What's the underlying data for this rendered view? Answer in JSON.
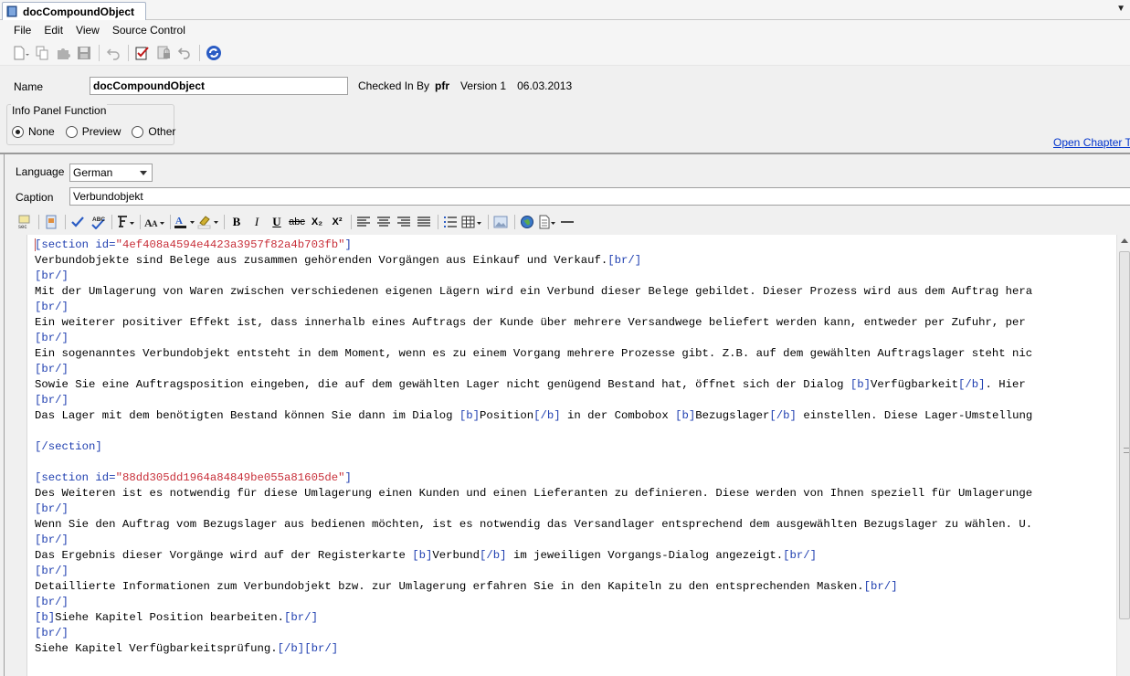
{
  "tab": {
    "title": "docCompoundObject"
  },
  "menu": {
    "items": [
      "File",
      "Edit",
      "View",
      "Source Control"
    ]
  },
  "header": {
    "name_label": "Name",
    "name_value": "docCompoundObject",
    "checked_in_label": "Checked In By",
    "checked_in_user": "pfr",
    "version": "Version 1",
    "date": "06.03.2013",
    "info_panel_label": "Info Panel Function",
    "radio_none": "None",
    "radio_preview": "Preview",
    "radio_other": "Other",
    "chapter_link": "Open Chapter Tre"
  },
  "form": {
    "language_label": "Language",
    "language_value": "German",
    "caption_label": "Caption",
    "caption_value": "Verbundobjekt"
  },
  "editor_toolbar": {
    "spell": "ABC",
    "bold": "B",
    "italic": "I",
    "underline": "U",
    "strike": "abc",
    "subscript": "X₂",
    "superscript": "X²"
  },
  "code_lines": [
    "[section id=\"4ef408a4594e4423a3957f82a4b703fb\"]",
    "Verbundobjekte sind Belege aus zusammen gehörenden Vorgängen aus Einkauf und Verkauf.[br/]",
    "[br/]",
    "Mit der Umlagerung von Waren zwischen verschiedenen eigenen Lägern wird ein Verbund dieser Belege gebildet. Dieser Prozess wird aus dem Auftrag hera",
    "[br/]",
    "Ein weiterer positiver Effekt ist, dass innerhalb eines Auftrags der Kunde über mehrere Versandwege beliefert werden kann, entweder per Zufuhr, per ",
    "[br/]",
    "Ein sogenanntes Verbundobjekt entsteht in dem Moment, wenn es zu einem Vorgang mehrere Prozesse gibt. Z.B. auf dem gewählten Auftragslager steht nic",
    "[br/]",
    "Sowie Sie eine Auftragsposition eingeben, die auf dem gewählten Lager nicht genügend Bestand hat, öffnet sich der Dialog [b]Verfügbarkeit[/b]. Hier ",
    "[br/]",
    "Das Lager mit dem benötigten Bestand können Sie dann im Dialog [b]Position[/b] in der Combobox [b]Bezugslager[/b] einstellen. Diese Lager-Umstellung",
    "",
    "[/section]",
    "",
    "[section id=\"88dd305dd1964a84849be055a81605de\"]",
    "Des Weiteren ist es notwendig für diese Umlagerung einen Kunden und einen Lieferanten zu definieren. Diese werden von Ihnen speziell für Umlagerunge",
    "[br/]",
    "Wenn Sie den Auftrag vom Bezugslager aus bedienen möchten, ist es notwendig das Versandlager entsprechend dem ausgewählten Bezugslager zu wählen. U.",
    "[br/]",
    "Das Ergebnis dieser Vorgänge wird auf der Registerkarte [b]Verbund[/b] im jeweiligen Vorgangs-Dialog angezeigt.[br/]",
    "[br/]",
    "Detaillierte Informationen zum Verbundobjekt bzw. zur Umlagerung erfahren Sie in den Kapiteln zu den entsprechenden Masken.[br/]",
    "[br/]",
    "[b]Siehe Kapitel Position bearbeiten.[br/]",
    "[br/]",
    "Siehe Kapitel Verfügbarkeitsprüfung.[/b][br/]"
  ],
  "colors": {
    "tag": "#1f3fb0",
    "string": "#c8303a",
    "link": "#0033cc"
  }
}
